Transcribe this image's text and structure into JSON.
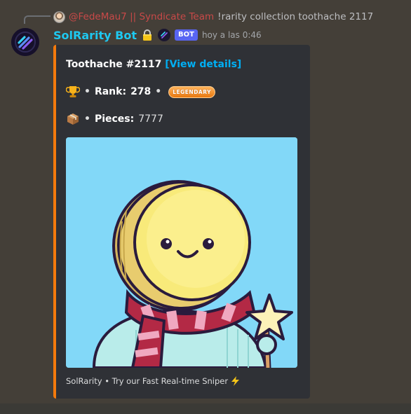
{
  "reply": {
    "author": "@FedeMau7 || Syndicate Team",
    "text": "!rarity collection toothache 2117"
  },
  "message": {
    "username": "SolRarity Bot",
    "badge": "BOT",
    "timestamp": "hoy a las 0:46"
  },
  "embed": {
    "accent_color": "#f47a0c",
    "title": "Toothache #2117",
    "link": "[View details]",
    "rank_label": "Rank:",
    "rank_value": "278",
    "rarity_badge": "LEGENDARY",
    "pieces_label": "Pieces:",
    "pieces_value": "7777",
    "separator": "•",
    "footer": "SolRarity • Try our Fast Real-time Sniper",
    "icons": {
      "rank": "trophy-icon",
      "pieces": "package-icon",
      "footer": "lightning-icon"
    }
  }
}
